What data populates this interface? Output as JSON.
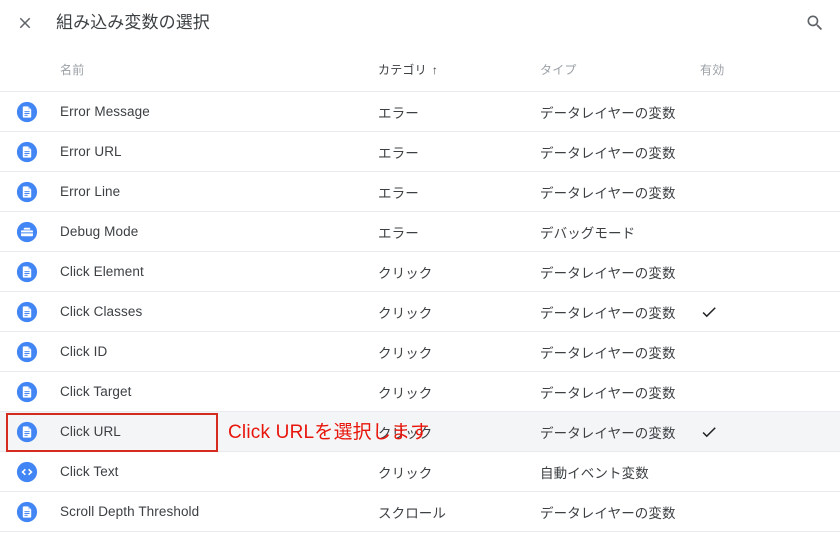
{
  "header": {
    "title": "組み込み変数の選択",
    "close_icon": "close-icon",
    "search_icon": "search-icon"
  },
  "table": {
    "columns": {
      "name": "名前",
      "category": "カテゴリ",
      "category_sort_arrow": "↑",
      "type": "タイプ",
      "enabled": "有効"
    },
    "rows": [
      {
        "icon": "document-icon",
        "name": "Error Message",
        "category": "エラー",
        "type": "データレイヤーの変数",
        "enabled": "",
        "highlighted": false
      },
      {
        "icon": "document-icon",
        "name": "Error URL",
        "category": "エラー",
        "type": "データレイヤーの変数",
        "enabled": "",
        "highlighted": false
      },
      {
        "icon": "document-icon",
        "name": "Error Line",
        "category": "エラー",
        "type": "データレイヤーの変数",
        "enabled": "",
        "highlighted": false
      },
      {
        "icon": "toolbox-icon",
        "name": "Debug Mode",
        "category": "エラー",
        "type": "デバッグモード",
        "enabled": "",
        "highlighted": false
      },
      {
        "icon": "document-icon",
        "name": "Click Element",
        "category": "クリック",
        "type": "データレイヤーの変数",
        "enabled": "",
        "highlighted": false
      },
      {
        "icon": "document-icon",
        "name": "Click Classes",
        "category": "クリック",
        "type": "データレイヤーの変数",
        "enabled": "✓",
        "highlighted": false
      },
      {
        "icon": "document-icon",
        "name": "Click ID",
        "category": "クリック",
        "type": "データレイヤーの変数",
        "enabled": "",
        "highlighted": false
      },
      {
        "icon": "document-icon",
        "name": "Click Target",
        "category": "クリック",
        "type": "データレイヤーの変数",
        "enabled": "",
        "highlighted": false
      },
      {
        "icon": "document-icon",
        "name": "Click URL",
        "category": "クリック",
        "type": "データレイヤーの変数",
        "enabled": "✓",
        "highlighted": true
      },
      {
        "icon": "code-icon",
        "name": "Click Text",
        "category": "クリック",
        "type": "自動イベント変数",
        "enabled": "",
        "highlighted": false
      },
      {
        "icon": "document-icon",
        "name": "Scroll Depth Threshold",
        "category": "スクロール",
        "type": "データレイヤーの変数",
        "enabled": "",
        "highlighted": false
      }
    ]
  },
  "annotation": {
    "text": "Click URLを選択します",
    "color": "#e8150b",
    "box_target_row": "Click URL"
  },
  "colors": {
    "icon_blue": "#4285f4",
    "text_primary": "#3c4043",
    "text_muted": "#9aa0a6",
    "row_divider": "#e8eaed",
    "row_highlight_bg": "#f4f5f6",
    "annotation_red": "#e8150b"
  }
}
